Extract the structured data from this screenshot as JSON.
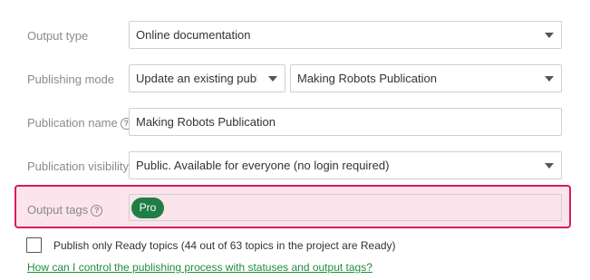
{
  "output_type": {
    "label": "Output type",
    "value": "Online documentation"
  },
  "publishing_mode": {
    "label": "Publishing mode",
    "mode_value": "Update an existing public",
    "publication_value": "Making Robots Publication"
  },
  "publication_name": {
    "label": "Publication name",
    "help_icon": "?",
    "value": "Making Robots Publication"
  },
  "publication_visibility": {
    "label": "Publication visibility",
    "value": "Public. Available for everyone (no login required)"
  },
  "output_tags": {
    "label": "Output tags",
    "help_icon": "?",
    "tags": [
      "Pro"
    ],
    "highlight_border": "#d81b60",
    "highlight_background": "#fce4ec",
    "tag_color": "#1e7e46"
  },
  "ready_only": {
    "label": "Publish only Ready topics (44 out of 63 topics in the project are Ready)",
    "checked": false
  },
  "help_link": {
    "text": "How can I control the publishing process with statuses and output tags?",
    "color": "#1e8e3e"
  }
}
